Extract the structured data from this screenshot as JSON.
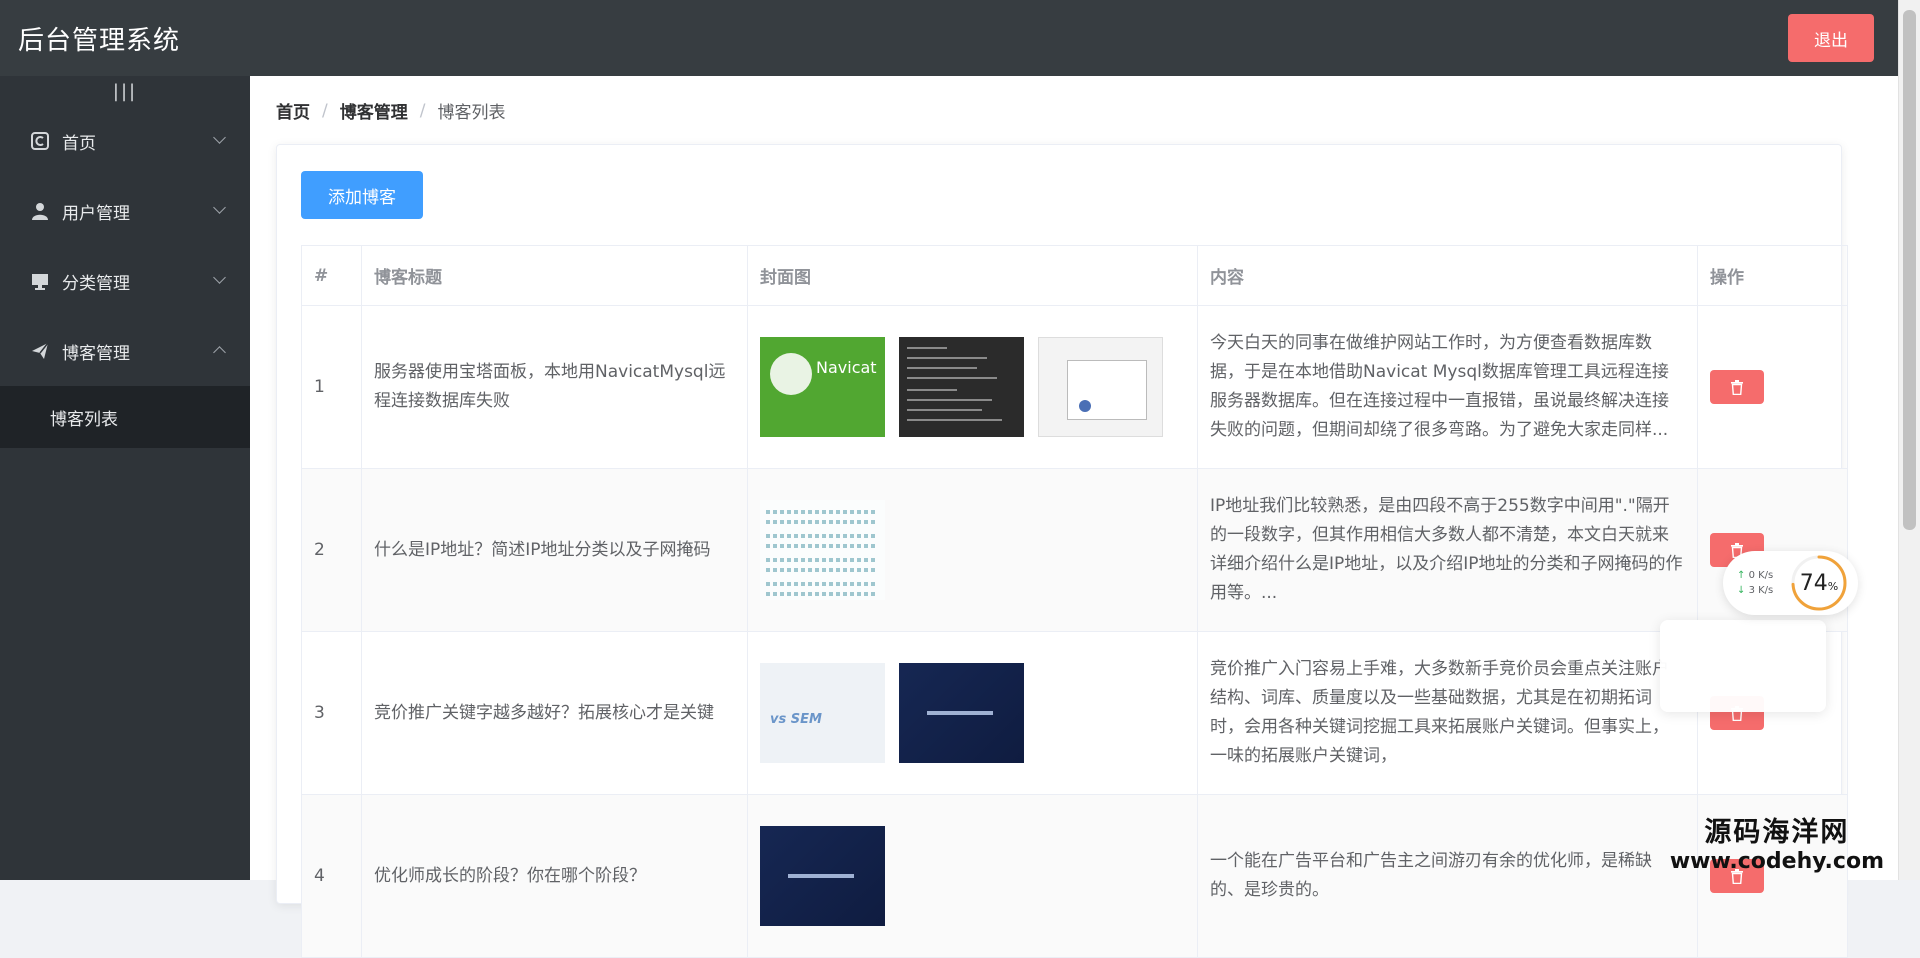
{
  "header": {
    "title": "后台管理系统",
    "logout_label": "退出"
  },
  "sidebar": {
    "toggle_label": "|||",
    "items": [
      {
        "label": "首页",
        "icon": "home-icon",
        "expanded": false
      },
      {
        "label": "用户管理",
        "icon": "user-icon",
        "expanded": false
      },
      {
        "label": "分类管理",
        "icon": "monitor-icon",
        "expanded": false
      },
      {
        "label": "博客管理",
        "icon": "paper-plane-icon",
        "expanded": true
      }
    ],
    "submenu": [
      {
        "label": "博客列表",
        "active": true
      }
    ]
  },
  "breadcrumb": {
    "items": [
      "首页",
      "博客管理",
      "博客列表"
    ],
    "separator": "/"
  },
  "toolbar": {
    "add_label": "添加博客"
  },
  "table": {
    "columns": [
      "#",
      "博客标题",
      "封面图",
      "内容",
      "操作"
    ],
    "rows": [
      {
        "index": "1",
        "title": "服务器使用宝塔面板，本地用NavicatMysql远程连接数据库失败",
        "covers": [
          "navicat-green",
          "code-dark",
          "dialog-light"
        ],
        "content": "今天白天的同事在做维护网站工作时，为方便查看数据库数据，于是在本地借助Navicat Mysql数据库管理工具远程连接服务器数据库。但在连接过程中一直报错，虽说最终解决连接失败的问题，但期间却绕了很多弯路。为了避免大家走同样..."
      },
      {
        "index": "2",
        "title": "什么是IP地址？简述IP地址分类以及子网掩码",
        "covers": [
          "ip-grid"
        ],
        "content": "IP地址我们比较熟悉，是由四段不高于255数字中间用\".\"隔开的一段数字，但其作用相信大多数人都不清楚，本文白天就来详细介绍什么是IP地址，以及介绍IP地址的分类和子网掩码的作用等。..."
      },
      {
        "index": "3",
        "title": "竞价推广关键字越多越好？拓展核心才是关键",
        "covers": [
          "sem-light",
          "navy-title"
        ],
        "content": "竞价推广入门容易上手难，大多数新手竞价员会重点关注账户结构、词库、质量度以及一些基础数据，尤其是在初期拓词时，会用各种关键词挖掘工具来拓展账户关键词。但事实上，一味的拓展账户关键词，"
      },
      {
        "index": "4",
        "title": "优化师成长的阶段？你在哪个阶段？",
        "covers": [
          "navy-title"
        ],
        "content": "一个能在广告平台和广告主之间游刃有余的优化师，是稀缺的、是珍贵的。"
      }
    ]
  },
  "net_widget": {
    "upload": "0  K/s",
    "download": "3  K/s",
    "percent": "74",
    "percent_unit": "%",
    "percent_value": 74
  },
  "watermark": {
    "name": "源码海洋网",
    "url": "www.codehy.com"
  },
  "colors": {
    "header_bg": "#373d41",
    "sidebar_bg": "#2f3439",
    "primary": "#409eff",
    "danger": "#f56c6c"
  }
}
